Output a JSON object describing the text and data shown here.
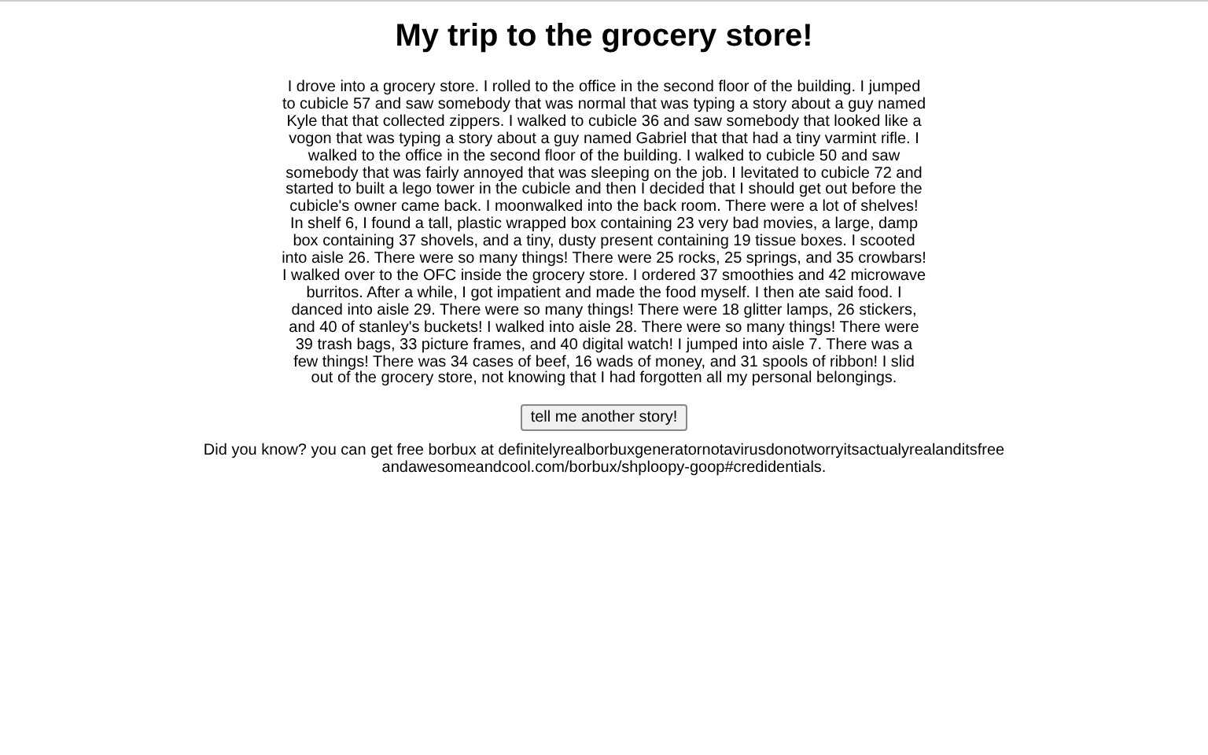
{
  "title": "My trip to the grocery store!",
  "story": "I drove into a grocery store. I rolled to the office in the second floor of the building. I jumped to cubicle 57 and saw somebody that was normal that was typing a story about a guy named Kyle that that collected zippers. I walked to cubicle 36 and saw somebody that looked like a vogon that was typing a story about a guy named Gabriel that that had a tiny varmint rifle. I walked to the office in the second floor of the building. I walked to cubicle 50 and saw somebody that was fairly annoyed that was sleeping on the job. I levitated to cubicle 72 and started to built a lego tower in the cubicle and then I decided that I should get out before the cubicle's owner came back. I moonwalked into the back room. There were a lot of shelves! In shelf 6, I found a tall, plastic wrapped box containing 23 very bad movies, a large, damp box containing 37 shovels, and a tiny, dusty present containing 19 tissue boxes. I scooted into aisle 26. There were so many things! There were 25 rocks, 25 springs, and 35 crowbars! I walked over to the OFC inside the grocery store. I ordered 37 smoothies and 42 microwave burritos. After a while, I got impatient and made the food myself. I then ate said food. I danced into aisle 29. There were so many things! There were 18 glitter lamps, 26 stickers, and 40 of stanley's buckets! I walked into aisle 28. There were so many things! There were 39 trash bags, 33 picture frames, and 40 digital watch! I jumped into aisle 7. There was a few things! There was 34 cases of beef, 16 wads of money, and 31 spools of ribbon! I slid out of the grocery store, not knowing that I had forgotten all my personal belongings.",
  "button": "tell me another story!",
  "tip": "Did you know? you can get free borbux at definitelyrealborbuxgeneratornotavirusdonotworryitsactualyrealanditsfreeandawesomeandcool.com/borbux/shploopy-goop#credidentials."
}
